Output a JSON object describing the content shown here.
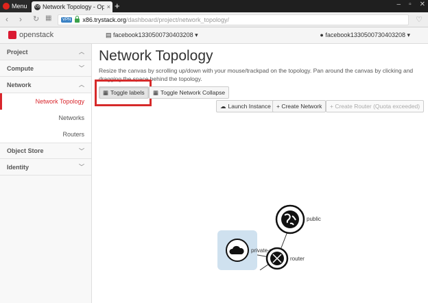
{
  "browser": {
    "menu_label": "Menu",
    "tab_title": "Network Topology - Ope",
    "tab_favicon": "OS",
    "new_tab": "+",
    "url_badge": "VPN",
    "url_host": "x86.trystack.org",
    "url_path": "/dashboard/project/network_topology/"
  },
  "header": {
    "logo_text": "openstack",
    "project_selector": "facebook1330500730403208 ▾",
    "user_menu": "facebook1330500730403208 ▾"
  },
  "sidebar": {
    "project": "Project",
    "compute": "Compute",
    "network": "Network",
    "items": [
      "Network Topology",
      "Networks",
      "Routers"
    ],
    "object_store": "Object Store",
    "identity": "Identity"
  },
  "main": {
    "title": "Network Topology",
    "description": "Resize the canvas by scrolling up/down with your mouse/trackpad on the topology. Pan around the canvas by clicking and dragging the space behind the topology.",
    "toggle_labels": "Toggle labels",
    "toggle_collapse": "Toggle Network Collapse",
    "launch_instance": "Launch Instance",
    "create_network": "+ Create Network",
    "create_router": "+ Create Router (Quota exceeded)"
  },
  "topology": {
    "nodes": {
      "network": "private-ne",
      "router": "router",
      "public": "public"
    }
  },
  "colors": {
    "accent": "#d9262c",
    "network_bg": "#cfe1ef"
  }
}
